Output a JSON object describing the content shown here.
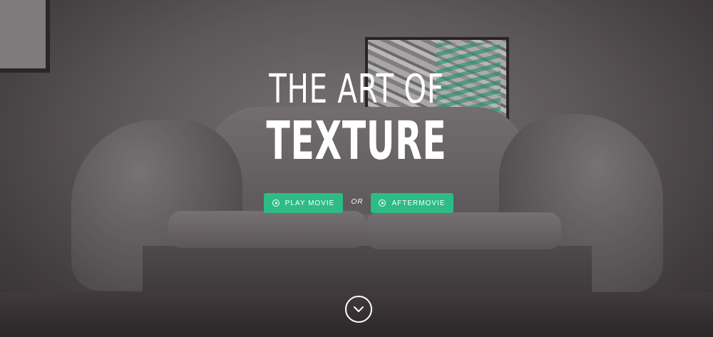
{
  "hero": {
    "title_line1": "THE ART OF",
    "title_line2": "TEXTURE"
  },
  "actions": {
    "play_label": "PLAY MOVIE",
    "separator": "OR",
    "aftermovie_label": "AFTERMOVIE"
  },
  "icons": {
    "play": "play-circle-icon",
    "scroll": "chevron-down-icon"
  },
  "colors": {
    "accent": "#2dbb86",
    "text": "#ffffff"
  }
}
